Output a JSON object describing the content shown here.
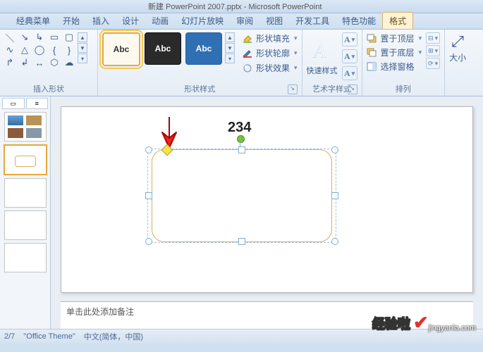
{
  "title": "新建 PowerPoint 2007.pptx - Microsoft PowerPoint",
  "tabs": {
    "classic": "经典菜单",
    "home": "开始",
    "insert": "插入",
    "design": "设计",
    "anim": "动画",
    "slideshow": "幻灯片放映",
    "review": "审阅",
    "view": "视图",
    "dev": "开发工具",
    "special": "特色功能",
    "format": "格式"
  },
  "groups": {
    "insert_shapes": "插入形状",
    "shape_styles": "形状样式",
    "wordart_styles": "艺术字样式",
    "arrange": "排列",
    "size": "大小"
  },
  "shapestyle": {
    "abc": "Abc",
    "fill": "形状填充",
    "outline": "形状轮廓",
    "effects": "形状效果"
  },
  "wordart": {
    "quick": "快速样式"
  },
  "arrange": {
    "front": "置于顶层",
    "back": "置于底层",
    "pane": "选择窗格"
  },
  "slide": {
    "number": "234",
    "notes_placeholder": "单击此处添加备注"
  },
  "status": {
    "slide_no": "2/7",
    "theme": "\"Office Theme\"",
    "lang": "中文(简体，中国)"
  },
  "watermark": {
    "brand": "经验啦",
    "url": "jingyanla.com"
  }
}
